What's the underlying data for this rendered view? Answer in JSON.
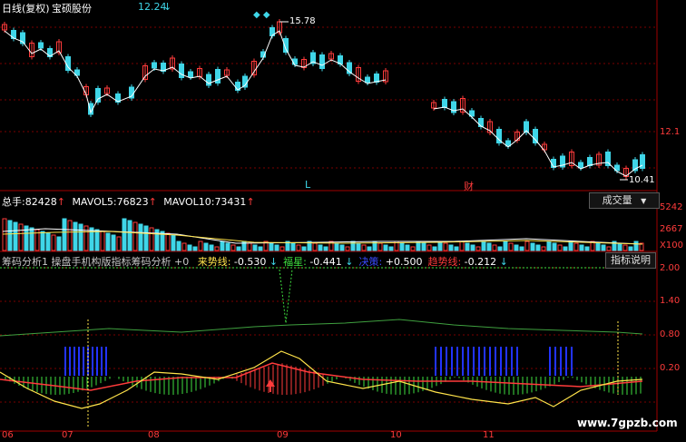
{
  "header": {
    "period_label": "日线(复权)",
    "stock_name": "宝硕股份",
    "price_value": "12.24",
    "price_arrow": "↓"
  },
  "price_panel": {
    "high_value": "15.78",
    "low_value": "10.41",
    "marker_L": "L",
    "marker_cai": "财",
    "axis_value": "12.1"
  },
  "volume_panel": {
    "total_label": "总手:",
    "total_value": "82428",
    "total_arrow": "↑",
    "mavol5_label": "MAVOL5:",
    "mavol5_value": "76823",
    "mavol5_arrow": "↑",
    "mavol10_label": "MAVOL10:",
    "mavol10_value": "73431",
    "mavol10_arrow": "↑",
    "dropdown_label": "成交量",
    "dropdown_arrow": "▼",
    "axis_labels": [
      "5242",
      "2667",
      "X100"
    ]
  },
  "indicator_panel": {
    "title": "筹码分析1 操盘手机构版指标筹码分析",
    "param": "+0",
    "items": [
      {
        "label": "来势线:",
        "value": "-0.530",
        "arrow": "↓",
        "color": "#ffe34a"
      },
      {
        "label": "福星:",
        "value": "-0.441",
        "arrow": "↓",
        "color": "#3fe03f"
      },
      {
        "label": "决策:",
        "value": "+0.500",
        "arrow": "",
        "color": "#3a4bff"
      },
      {
        "label": "趋势线:",
        "value": "-0.212",
        "arrow": "↓",
        "color": "#ff3b3b"
      }
    ],
    "help_button": "指标说明",
    "axis_labels": [
      "2.00",
      "1.40",
      "0.80",
      "0.20"
    ]
  },
  "x_axis": {
    "labels": [
      "06",
      "07",
      "08",
      "09",
      "10",
      "11"
    ]
  },
  "watermark": "www.7gpzb.com",
  "colors": {
    "up": "#ff3b3b",
    "down": "#3fd6e8",
    "grid": "#7a0000",
    "background": "#000000"
  }
}
